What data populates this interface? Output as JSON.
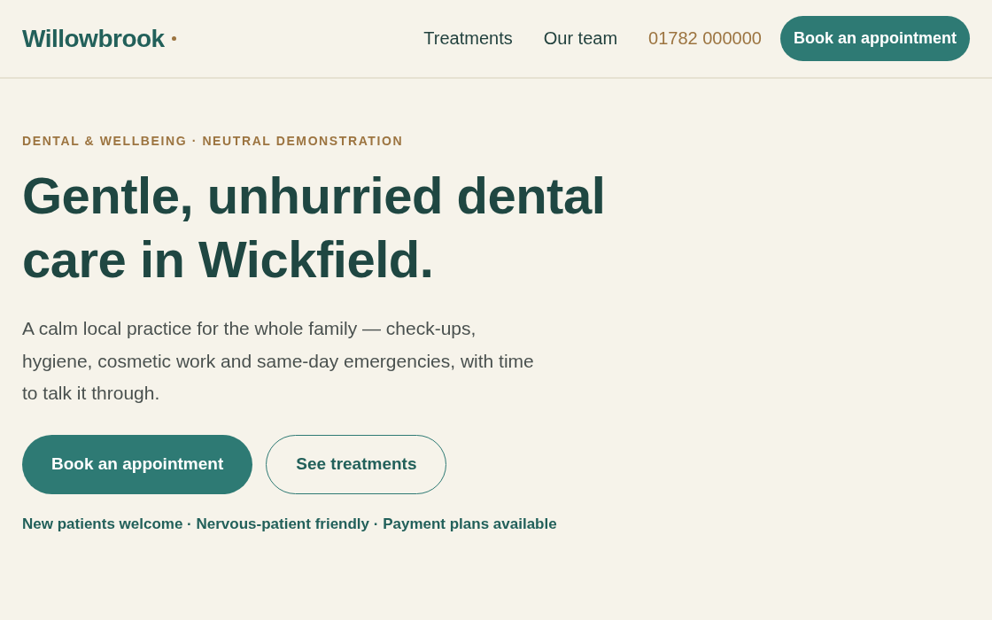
{
  "header": {
    "logo": "Willowbrook",
    "nav": [
      {
        "kind": "link",
        "label": "Treatments"
      },
      {
        "kind": "link",
        "label": "Our team"
      },
      {
        "kind": "phone",
        "label": "01782 000000"
      },
      {
        "kind": "button",
        "label": "Book an appointment"
      }
    ]
  },
  "hero": {
    "eyebrow": "DENTAL & WELLBEING · NEUTRAL DEMONSTRATION",
    "heading": "Gentle, unhurried dental care in Wickfield.",
    "lede": "A calm local practice for the whole family — check-ups, hygiene, cosmetic work and same-day emergencies, with time to talk it through.",
    "buttons": [
      {
        "kind": "primary",
        "label": "Book an appointment"
      },
      {
        "kind": "secondary",
        "label": "See treatments"
      }
    ],
    "note": "New patients welcome · Nervous-patient friendly · Payment plans available"
  }
}
